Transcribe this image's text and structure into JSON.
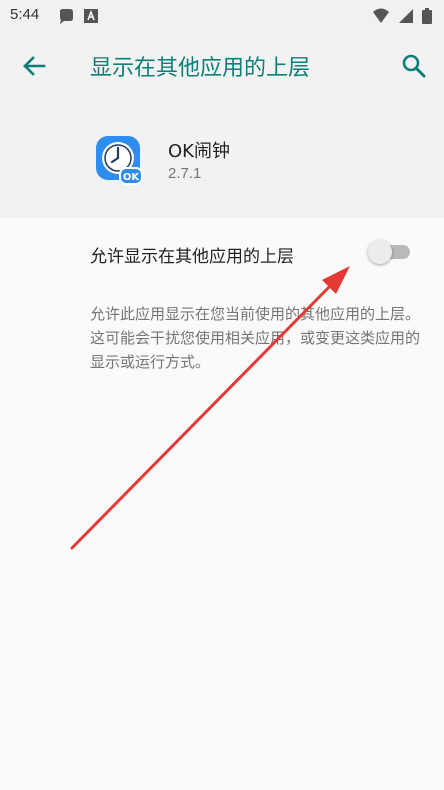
{
  "status_bar": {
    "time": "5:44",
    "left_icons": [
      "notification-icon",
      "font-icon"
    ],
    "right_icons": [
      "wifi-icon",
      "signal-icon",
      "battery-icon"
    ]
  },
  "toolbar": {
    "title": "显示在其他应用的上层",
    "back_icon": "arrow-left-icon",
    "search_icon": "search-icon",
    "accent_color": "#0b7f78"
  },
  "app": {
    "name": "OK闹钟",
    "version": "2.7.1",
    "icon": "alarm-clock-icon",
    "icon_badge": "OK"
  },
  "setting": {
    "label": "允许显示在其他应用的上层",
    "enabled": false
  },
  "description": "允许此应用显示在您当前使用的其他应用的上层。这可能会干扰您使用相关应用，或变更这类应用的显示或运行方式。",
  "annotation": {
    "type": "red-arrow",
    "color": "#e53935",
    "points_to": "setting-switch"
  }
}
